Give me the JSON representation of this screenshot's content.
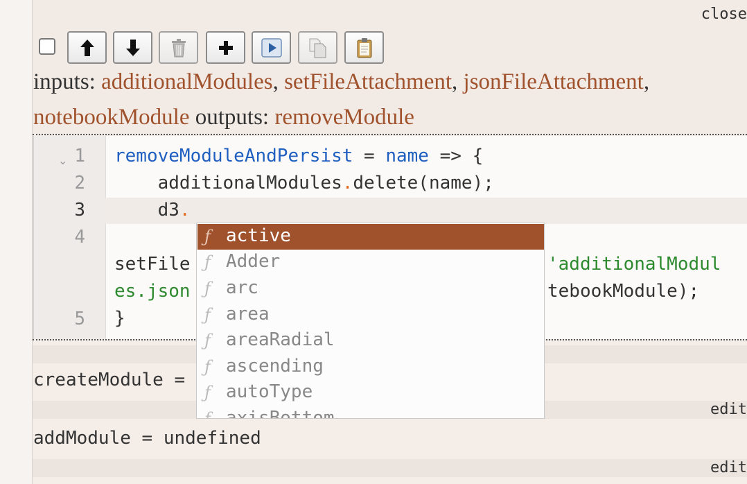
{
  "cell": {
    "close_label": "close",
    "inputs_label": "inputs: ",
    "outputs_label": " outputs: ",
    "inputs": [
      "additionalModules",
      "setFileAttachment",
      "jsonFileAttachment",
      "notebookModule"
    ],
    "outputs": [
      "removeModule"
    ],
    "separator": ", "
  },
  "toolbar": {
    "buttons": [
      "move-up-icon",
      "move-down-icon",
      "trash-icon",
      "add-icon",
      "run-icon",
      "copy-icon",
      "paste-icon"
    ]
  },
  "editor": {
    "line_numbers": [
      "1",
      "2",
      "3",
      "4",
      "5"
    ],
    "line1_name": "removeModuleAndPersist",
    "line1_op": " = ",
    "line1_param": "name",
    "line1_rest": " => {",
    "line2_a": "    additionalModules",
    "line2_b": "delete(name);",
    "line3_a": "    d3",
    "line4_a": "setFile",
    "line4_b": "'additionalModul",
    "line4c_a": "es.json",
    "line4c_b": "tebookModule);",
    "line5": "}"
  },
  "autocomplete": {
    "selected": "active",
    "options": [
      "active",
      "Adder",
      "arc",
      "area",
      "areaRadial",
      "ascending",
      "autoType",
      "axisBottom"
    ],
    "kind_glyph": "ƒ"
  },
  "cells": [
    {
      "code": "createModule = ",
      "action": "edit"
    },
    {
      "code": "addModule = undefined",
      "action": "edit"
    }
  ],
  "colors": {
    "accent": "#a0522d",
    "keyword": "#1f5fbf",
    "string": "#2e8a2e"
  }
}
